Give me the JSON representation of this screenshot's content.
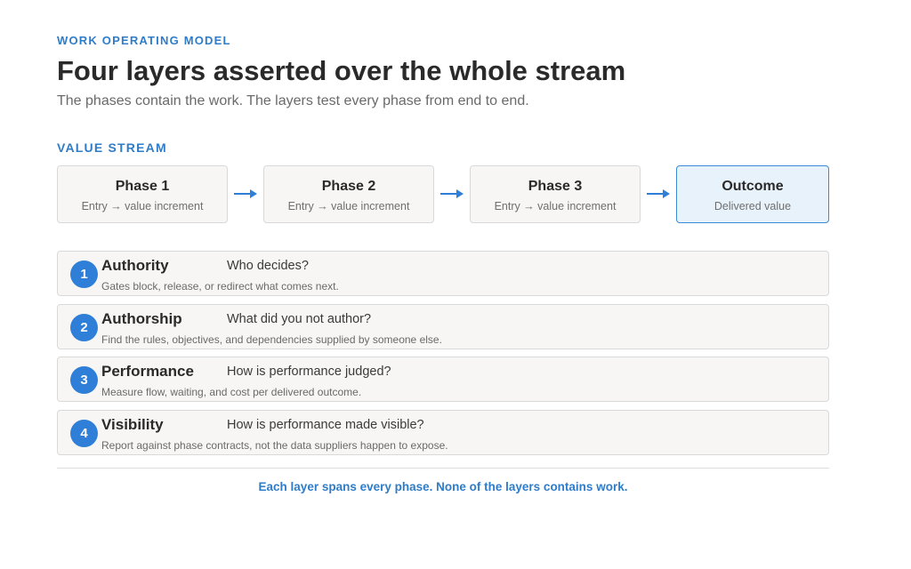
{
  "header": {
    "eyebrow": "WORK OPERATING MODEL",
    "title": "Four layers asserted over the whole stream",
    "subtitle": "The phases contain the work. The layers test every phase from end to end."
  },
  "value_stream": {
    "label": "VALUE STREAM",
    "phases": [
      {
        "title": "Phase 1",
        "subtitle": "Entry → value increment"
      },
      {
        "title": "Phase 2",
        "subtitle": "Entry → value increment"
      },
      {
        "title": "Phase 3",
        "subtitle": "Entry → value increment"
      }
    ],
    "outcome": {
      "title": "Outcome",
      "subtitle": "Delivered value"
    },
    "accent_color": "#2f7fd8"
  },
  "layers": [
    {
      "number": "1",
      "name": "Authority",
      "question": "Who decides?",
      "description": "Gates block, release, or redirect what comes next."
    },
    {
      "number": "2",
      "name": "Authorship",
      "question": "What did you not author?",
      "description": "Find the rules, objectives, and dependencies supplied by someone else."
    },
    {
      "number": "3",
      "name": "Performance",
      "question": "How is performance judged?",
      "description": "Measure flow, waiting, and cost per delivered outcome."
    },
    {
      "number": "4",
      "name": "Visibility",
      "question": "How is performance made visible?",
      "description": "Report against phase contracts, not the data suppliers happen to expose."
    }
  ],
  "footer": {
    "text": "Each layer spans every phase. None of the layers contains work."
  }
}
